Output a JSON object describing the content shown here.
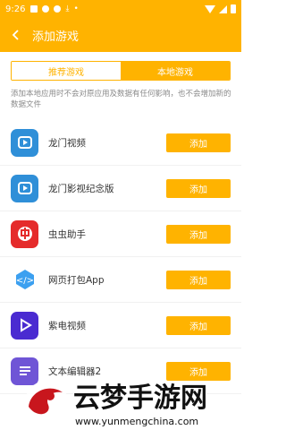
{
  "status": {
    "time": "9:26"
  },
  "appbar": {
    "title": "添加游戏"
  },
  "tabs": [
    {
      "label": "推荐游戏",
      "active": false
    },
    {
      "label": "本地游戏",
      "active": true
    }
  ],
  "notice": "添加本地应用时不会对原应用及数据有任何影响，也不会增加新的数据文件",
  "apps": [
    {
      "name": "龙门视频",
      "button": "添加",
      "icon": "video-app-icon"
    },
    {
      "name": "龙门影视纪念版",
      "button": "添加",
      "icon": "video-app-icon"
    },
    {
      "name": "虫虫助手",
      "button": "添加",
      "icon": "chongchong-app-icon"
    },
    {
      "name": "网页打包App",
      "button": "添加",
      "icon": "code-app-icon"
    },
    {
      "name": "紫电视频",
      "button": "添加",
      "icon": "play-app-icon"
    },
    {
      "name": "文本编辑器2",
      "button": "添加",
      "icon": "list-app-icon"
    }
  ],
  "watermark": {
    "text": "云梦手游网",
    "url": "www.yunmengchina.com"
  },
  "colors": {
    "accent": "#ffb300"
  }
}
